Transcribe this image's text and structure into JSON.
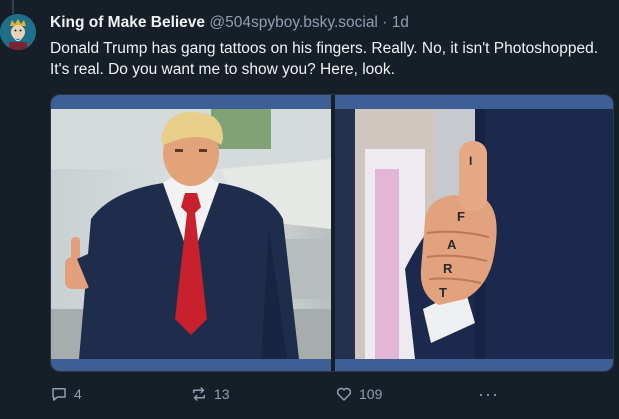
{
  "post": {
    "display_name": "King of Make Believe",
    "handle": "@504spyboy.bsky.social",
    "separator": "·",
    "time": "1d",
    "text": "Donald Trump has gang tattoos on his fingers. Really. No, it isn't Photoshopped. It's real. Do you want me to show you? Here, look."
  },
  "images": [
    {
      "icon": "photo-trump-thumbs-up"
    },
    {
      "icon": "photo-thumb-closeup",
      "finger_tattoo_letters": [
        "I",
        "F",
        "A",
        "R",
        "T"
      ]
    }
  ],
  "actions": {
    "reply_count": "4",
    "repost_count": "13",
    "like_count": "109",
    "more_label": "···"
  },
  "colors": {
    "background": "#161e27",
    "text": "#f1f3f5",
    "muted": "#8d9fb2",
    "image_frame": "#3e5f95"
  }
}
